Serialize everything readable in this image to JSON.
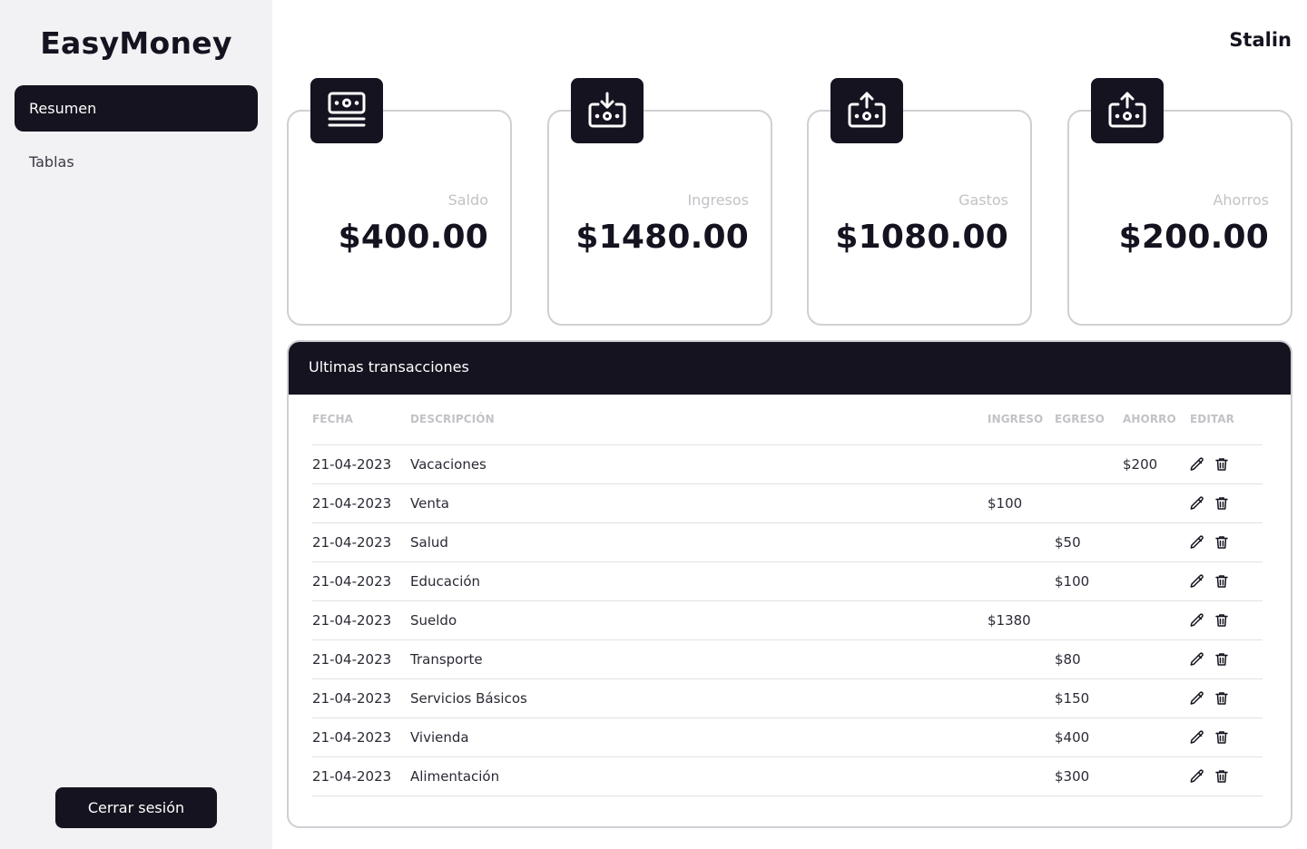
{
  "app": {
    "brand": "EasyMoney",
    "username": "Stalin"
  },
  "sidebar": {
    "items": [
      {
        "label": "Resumen",
        "active": true
      },
      {
        "label": "Tablas",
        "active": false
      }
    ],
    "logout_label": "Cerrar sesión"
  },
  "cards": [
    {
      "label": "Saldo",
      "value": "$400.00",
      "icon": "money-bill-icon"
    },
    {
      "label": "Ingresos",
      "value": "$1480.00",
      "icon": "cash-in-icon"
    },
    {
      "label": "Gastos",
      "value": "$1080.00",
      "icon": "cash-out-icon"
    },
    {
      "label": "Ahorros",
      "value": "$200.00",
      "icon": "cash-out-icon"
    }
  ],
  "transactions": {
    "title": "Ultimas transacciones",
    "columns": [
      "FECHA",
      "DESCRIPCIÓN",
      "INGRESO",
      "EGRESO",
      "AHORRO",
      "EDITAR"
    ],
    "rows": [
      {
        "fecha": "21-04-2023",
        "descripcion": "Vacaciones",
        "ingreso": "",
        "egreso": "",
        "ahorro": "$200"
      },
      {
        "fecha": "21-04-2023",
        "descripcion": "Venta",
        "ingreso": "$100",
        "egreso": "",
        "ahorro": ""
      },
      {
        "fecha": "21-04-2023",
        "descripcion": "Salud",
        "ingreso": "",
        "egreso": "$50",
        "ahorro": ""
      },
      {
        "fecha": "21-04-2023",
        "descripcion": "Educación",
        "ingreso": "",
        "egreso": "$100",
        "ahorro": ""
      },
      {
        "fecha": "21-04-2023",
        "descripcion": "Sueldo",
        "ingreso": "$1380",
        "egreso": "",
        "ahorro": ""
      },
      {
        "fecha": "21-04-2023",
        "descripcion": "Transporte",
        "ingreso": "",
        "egreso": "$80",
        "ahorro": ""
      },
      {
        "fecha": "21-04-2023",
        "descripcion": "Servicios Básicos",
        "ingreso": "",
        "egreso": "$150",
        "ahorro": ""
      },
      {
        "fecha": "21-04-2023",
        "descripcion": "Vivienda",
        "ingreso": "",
        "egreso": "$400",
        "ahorro": ""
      },
      {
        "fecha": "21-04-2023",
        "descripcion": "Alimentación",
        "ingreso": "",
        "egreso": "$300",
        "ahorro": ""
      }
    ]
  },
  "colors": {
    "dark": "#14131f",
    "sidebar_bg": "#f2f1f3",
    "muted": "#c2c2c7",
    "border": "#cfcfd4"
  }
}
